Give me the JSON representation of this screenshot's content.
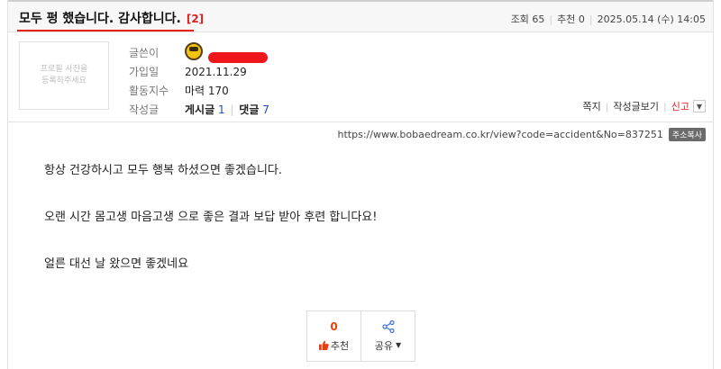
{
  "post": {
    "title": "모두 펑 했습니다. 감사합니다.",
    "comment_count": "[2]",
    "views_label": "조회 65",
    "recommend_label": "추천 0",
    "date": "2025.05.14 (수) 14:05"
  },
  "author": {
    "avatar_placeholder": "프로필 사진을\n등록하주세요",
    "labels": {
      "writer": "글쓴이",
      "joined": "가입일",
      "activity": "활동지수",
      "posts": "작성글"
    },
    "joined": "2021.11.29",
    "activity": "마력 170",
    "post_label": "게시글",
    "post_count": "1",
    "reply_label": "댓글",
    "reply_count": "7",
    "level_icon": "character-level-icon",
    "redaction_color": "#f0161a"
  },
  "actions": {
    "message": "쪽지",
    "view_posts": "작성글보기",
    "report": "신고",
    "dropdown_icon": "chevron-down-icon"
  },
  "url": {
    "text": "https://www.bobaedream.co.kr/view?code=accident&No=837251",
    "copy_label": "주소복사"
  },
  "content": {
    "paragraphs": [
      "항상 건강하시고 모두 행복 하셨으면 좋겠습니다.",
      "오랜 시간 몸고생 마음고생 으로 좋은 결과 보답 받아 후련 합니다요!",
      "얼른 대선 날 왔으면 좋겠네요"
    ]
  },
  "reactions": {
    "recommend_count": "0",
    "recommend_label": "추천",
    "share_label": "공유",
    "recommend_icon": "thumbs-up-icon",
    "share_icon": "share-icon",
    "accent_color": "#e8400d"
  }
}
